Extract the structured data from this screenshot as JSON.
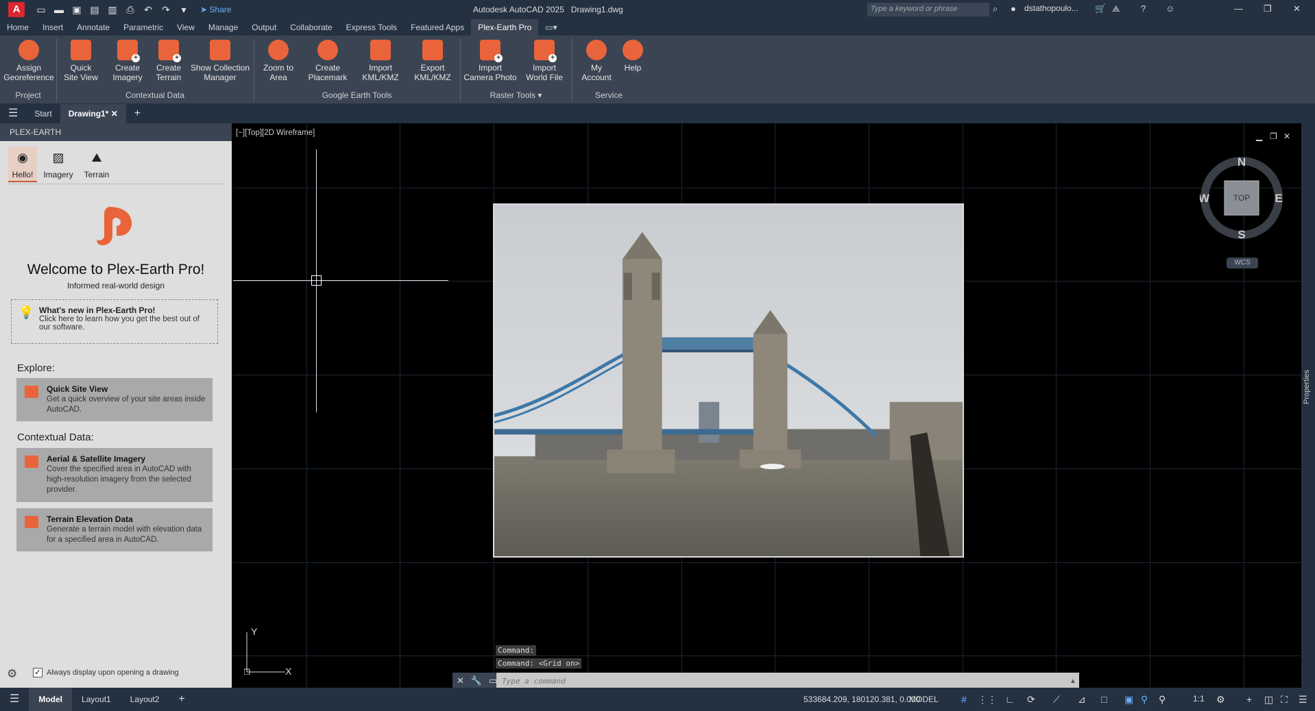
{
  "window": {
    "title_app": "Autodesk AutoCAD 2025",
    "title_file": "Drawing1.dwg",
    "search_placeholder": "Type a keyword or phrase",
    "user": "dstathopoulo...",
    "share": "Share",
    "logo": "A"
  },
  "menu": [
    "Home",
    "Insert",
    "Annotate",
    "Parametric",
    "View",
    "Manage",
    "Output",
    "Collaborate",
    "Express Tools",
    "Featured Apps",
    "Plex-Earth Pro"
  ],
  "ribbon": {
    "buttons": [
      {
        "l1": "Assign",
        "l2": "Georeference",
        "icon": "georeference-icon"
      },
      {
        "l1": "Quick",
        "l2": "Site View",
        "icon": "quick-site-view-icon"
      },
      {
        "l1": "Create",
        "l2": "Imagery",
        "icon": "create-imagery-icon"
      },
      {
        "l1": "Create",
        "l2": "Terrain",
        "icon": "create-terrain-icon"
      },
      {
        "l1": "Show Collection",
        "l2": "Manager",
        "icon": "collection-manager-icon"
      },
      {
        "l1": "Zoom to",
        "l2": "Area",
        "icon": "zoom-to-area-icon"
      },
      {
        "l1": "Create",
        "l2": "Placemark",
        "icon": "placemark-icon"
      },
      {
        "l1": "Import",
        "l2": "KML/KMZ",
        "icon": "import-kml-icon"
      },
      {
        "l1": "Export",
        "l2": "KML/KMZ",
        "icon": "export-kml-icon"
      },
      {
        "l1": "Import",
        "l2": "Camera Photo",
        "icon": "camera-photo-icon"
      },
      {
        "l1": "Import",
        "l2": "World File",
        "icon": "world-file-icon"
      },
      {
        "l1": "My",
        "l2": "Account",
        "icon": "account-icon"
      },
      {
        "l1": "Help",
        "l2": "",
        "icon": "help-icon"
      }
    ],
    "groups": [
      "Project",
      "Contextual Data",
      "Google Earth Tools",
      "Raster Tools",
      "Service"
    ]
  },
  "filetabs": {
    "start": "Start",
    "drawing": "Drawing1*"
  },
  "panel": {
    "title": "PLEX-EARTH",
    "tabs": [
      "Hello!",
      "Imagery",
      "Terrain"
    ],
    "welcome_title": "Welcome to Plex-Earth Pro!",
    "welcome_sub": "Informed real-world design",
    "whatsnew_title": "What's new in Plex-Earth Pro!",
    "whatsnew_body": "Click here to learn how you get the best out of our software.",
    "explore": "Explore:",
    "contextual": "Contextual Data:",
    "cards": [
      {
        "title": "Quick Site View",
        "body": "Get a quick overview of your site areas inside AutoCAD."
      },
      {
        "title": "Aerial & Satellite Imagery",
        "body": "Cover the specified area in AutoCAD with high-resolution imagery from the selected provider."
      },
      {
        "title": "Terrain Elevation Data",
        "body": "Generate a terrain model with elevation data for a specified area in AutoCAD."
      }
    ],
    "always_display": "Always display upon opening a drawing"
  },
  "viewport": {
    "label": "[−][Top][2D Wireframe]",
    "compass": {
      "n": "N",
      "s": "S",
      "e": "E",
      "w": "W",
      "top": "TOP"
    },
    "wcs": "WCS",
    "ucs_x": "X",
    "ucs_y": "Y",
    "properties": "Properties"
  },
  "command": {
    "history": [
      "Command:",
      "Command:  <Grid on>"
    ],
    "placeholder": "Type a command"
  },
  "status": {
    "tabs": [
      "Model",
      "Layout1",
      "Layout2"
    ],
    "coords": "533684.209, 180120.381, 0.000",
    "model": "MODEL",
    "scale": "1:1"
  }
}
